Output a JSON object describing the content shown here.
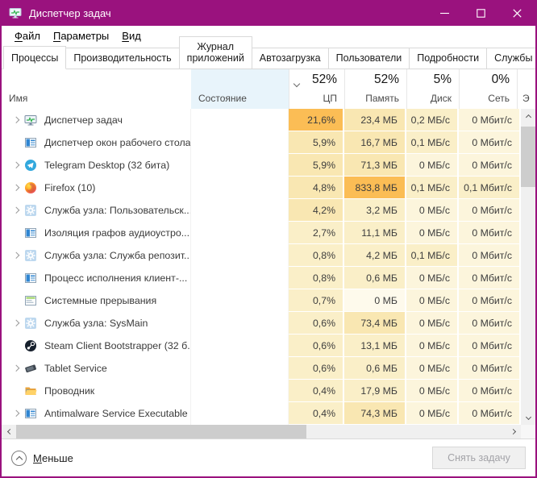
{
  "window": {
    "title": "Диспетчер задач"
  },
  "menu": {
    "items": [
      "Файл",
      "Параметры",
      "Вид"
    ]
  },
  "tabs": {
    "active": "Процессы",
    "items": [
      "Процессы",
      "Производительность",
      "Журнал приложений",
      "Автозагрузка",
      "Пользователи",
      "Подробности",
      "Службы"
    ]
  },
  "header": {
    "name": "Имя",
    "status": "Состояние",
    "cpu_pct": "52%",
    "cpu_label": "ЦП",
    "mem_pct": "52%",
    "mem_label": "Память",
    "disk_pct": "5%",
    "disk_label": "Диск",
    "net_pct": "0%",
    "net_label": "Сеть",
    "power_label_clipped": "Э"
  },
  "processes": [
    {
      "name": "Диспетчер задач",
      "icon": "task-manager",
      "expandable": true,
      "cpu": "21,6%",
      "mem": "23,4 МБ",
      "disk": "0,2 МБ/с",
      "net": "0 Мбит/с",
      "heat": {
        "cpu": 4,
        "mem": 2,
        "disk": 1,
        "net": 0
      }
    },
    {
      "name": "Диспетчер окон рабочего стола",
      "icon": "window",
      "expandable": false,
      "cpu": "5,9%",
      "mem": "16,7 МБ",
      "disk": "0,1 МБ/с",
      "net": "0 Мбит/с",
      "heat": {
        "cpu": 2,
        "mem": 2,
        "disk": 1,
        "net": 0
      }
    },
    {
      "name": "Telegram Desktop (32 бита)",
      "icon": "telegram",
      "expandable": true,
      "cpu": "5,9%",
      "mem": "71,3 МБ",
      "disk": "0 МБ/с",
      "net": "0 Мбит/с",
      "heat": {
        "cpu": 2,
        "mem": 2,
        "disk": 0,
        "net": 0
      }
    },
    {
      "name": "Firefox (10)",
      "icon": "firefox",
      "expandable": true,
      "cpu": "4,8%",
      "mem": "833,8 МБ",
      "disk": "0,1 МБ/с",
      "net": "0,1 Мбит/с",
      "heat": {
        "cpu": 2,
        "mem": 4,
        "disk": 1,
        "net": 1
      }
    },
    {
      "name": "Служба узла: Пользовательск...",
      "icon": "gear",
      "expandable": true,
      "cpu": "4,2%",
      "mem": "3,2 МБ",
      "disk": "0 МБ/с",
      "net": "0 Мбит/с",
      "heat": {
        "cpu": 2,
        "mem": 1,
        "disk": 0,
        "net": 0
      }
    },
    {
      "name": "Изоляция графов аудиоустро...",
      "icon": "window",
      "expandable": false,
      "cpu": "2,7%",
      "mem": "11,1 МБ",
      "disk": "0 МБ/с",
      "net": "0 Мбит/с",
      "heat": {
        "cpu": 1,
        "mem": 1,
        "disk": 0,
        "net": 0
      }
    },
    {
      "name": "Служба узла: Служба репозит...",
      "icon": "gear",
      "expandable": true,
      "cpu": "0,8%",
      "mem": "4,2 МБ",
      "disk": "0,1 МБ/с",
      "net": "0 Мбит/с",
      "heat": {
        "cpu": 1,
        "mem": 1,
        "disk": 1,
        "net": 0
      }
    },
    {
      "name": "Процесс исполнения клиент-...",
      "icon": "window",
      "expandable": false,
      "cpu": "0,8%",
      "mem": "0,6 МБ",
      "disk": "0 МБ/с",
      "net": "0 Мбит/с",
      "heat": {
        "cpu": 1,
        "mem": 1,
        "disk": 0,
        "net": 0
      }
    },
    {
      "name": "Системные прерывания",
      "icon": "system",
      "expandable": false,
      "cpu": "0,7%",
      "mem": "0 МБ",
      "disk": "0 МБ/с",
      "net": "0 Мбит/с",
      "heat": {
        "cpu": 1,
        "mem": 5,
        "disk": 0,
        "net": 0
      }
    },
    {
      "name": "Служба узла: SysMain",
      "icon": "gear",
      "expandable": true,
      "cpu": "0,6%",
      "mem": "73,4 МБ",
      "disk": "0 МБ/с",
      "net": "0 Мбит/с",
      "heat": {
        "cpu": 1,
        "mem": 2,
        "disk": 0,
        "net": 0
      }
    },
    {
      "name": "Steam Client Bootstrapper (32 б...",
      "icon": "steam",
      "expandable": false,
      "cpu": "0,6%",
      "mem": "13,1 МБ",
      "disk": "0 МБ/с",
      "net": "0 Мбит/с",
      "heat": {
        "cpu": 1,
        "mem": 1,
        "disk": 0,
        "net": 0
      }
    },
    {
      "name": "Tablet Service",
      "icon": "tablet",
      "expandable": true,
      "cpu": "0,6%",
      "mem": "0,6 МБ",
      "disk": "0 МБ/с",
      "net": "0 Мбит/с",
      "heat": {
        "cpu": 1,
        "mem": 1,
        "disk": 0,
        "net": 0
      }
    },
    {
      "name": "Проводник",
      "icon": "folder",
      "expandable": false,
      "cpu": "0,4%",
      "mem": "17,9 МБ",
      "disk": "0 МБ/с",
      "net": "0 Мбит/с",
      "heat": {
        "cpu": 1,
        "mem": 1,
        "disk": 0,
        "net": 0
      }
    },
    {
      "name": "Antimalware Service Executable",
      "icon": "window",
      "expandable": true,
      "cpu": "0,4%",
      "mem": "74,3 МБ",
      "disk": "0 МБ/с",
      "net": "0 Мбит/с",
      "heat": {
        "cpu": 1,
        "mem": 2,
        "disk": 0,
        "net": 0
      }
    }
  ],
  "footer": {
    "less_label": "Меньше",
    "end_task_label": "Снять задачу",
    "end_task_accel_index": 8
  },
  "icons": {
    "titlebar": "task-manager-icon",
    "sort": "chevron-down-icon",
    "expander": "chevron-right-icon",
    "scrollbar": [
      "chevron-up-icon",
      "chevron-down-icon",
      "chevron-left-icon",
      "chevron-right-icon"
    ],
    "less": "chevron-up-circle-icon"
  },
  "colors": {
    "titlebar": "#9A127E",
    "status_header_bg": "#E8F4FB",
    "heat_scale": [
      "#FCF5DC",
      "#FAEFC8",
      "#F9E7B2",
      "#F7DFA0",
      "#FBBD55",
      "#FEFAEC"
    ],
    "scroll_thumb": "#CDCDCD",
    "scroll_track": "#F0F0F0"
  }
}
